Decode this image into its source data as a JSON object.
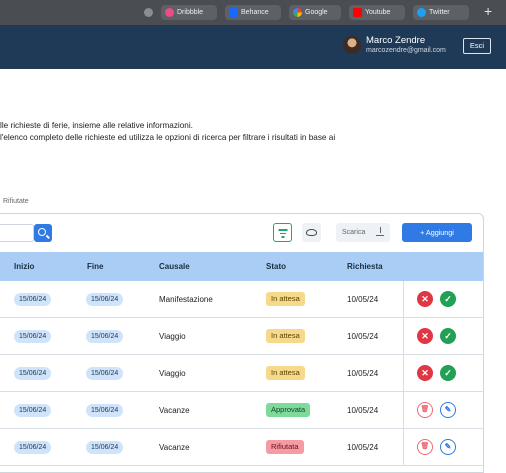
{
  "bookmarks": [
    {
      "label": "Dribbble",
      "icon": "dribbble-icon",
      "color": "#ea4c89"
    },
    {
      "label": "Behance",
      "icon": "behance-icon",
      "color": "#1769ff"
    },
    {
      "label": "Google",
      "icon": "google-icon",
      "color": "#4285f4"
    },
    {
      "label": "Youtube",
      "icon": "youtube-icon",
      "color": "#ff0000"
    },
    {
      "label": "Twitter",
      "icon": "twitter-icon",
      "color": "#1da1f2"
    }
  ],
  "user": {
    "name": "Marco Zendre",
    "email": "marcozendre@gmail.com",
    "logout_label": "Esci"
  },
  "description": [
    "lle richieste di ferie, insieme alle relative informazioni.",
    " l'elenco completo delle richieste ed utilizza le opzioni di ricerca per filtrare i risultati in base ai"
  ],
  "tabs": {
    "rejected_label": "Rifiutate"
  },
  "toolbar": {
    "download_label": "Scarica",
    "add_label": "+ Aggiungi"
  },
  "table": {
    "headers": {
      "start": "Inizio",
      "end": "Fine",
      "reason": "Causale",
      "status": "Stato",
      "requested": "Richiesta"
    },
    "rows": [
      {
        "start": "15/06/24",
        "end": "15/06/24",
        "reason": "Manifestazione",
        "status": "In attesa",
        "status_kind": "pending",
        "requested": "10/05/24"
      },
      {
        "start": "15/06/24",
        "end": "15/06/24",
        "reason": "Viaggio",
        "status": "In attesa",
        "status_kind": "pending",
        "requested": "10/05/24"
      },
      {
        "start": "15/06/24",
        "end": "15/06/24",
        "reason": "Viaggio",
        "status": "In attesa",
        "status_kind": "pending",
        "requested": "10/05/24"
      },
      {
        "start": "15/06/24",
        "end": "15/06/24",
        "reason": "Vacanze",
        "status": "Approvata",
        "status_kind": "approved",
        "requested": "10/05/24"
      },
      {
        "start": "15/06/24",
        "end": "15/06/24",
        "reason": "Vacanze",
        "status": "Rifiutata",
        "status_kind": "rejected",
        "requested": "10/05/24"
      }
    ]
  },
  "colors": {
    "header_bar": "#1f3a57",
    "accent": "#2f7ae5",
    "table_header": "#a9cdf5"
  }
}
